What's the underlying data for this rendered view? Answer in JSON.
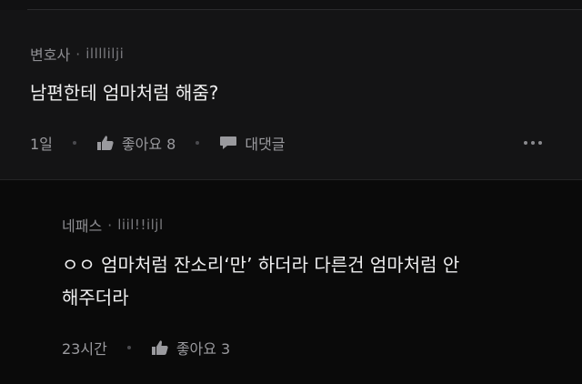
{
  "comment": {
    "author": "변호사",
    "separator": "·",
    "handle": "illllilji",
    "text": "남편한테 엄마처럼 해줌?",
    "time": "1일",
    "like_label": "좋아요 8",
    "reply_label": "대댓글"
  },
  "reply": {
    "author": "네패스",
    "separator": "·",
    "handle": "liil!!iljl",
    "text_line1": "ㅇㅇ 엄마처럼 잔소리‘만’ 하더라 다른건 엄마처럼 안",
    "text_line2": "해주더라",
    "time": "23시간",
    "like_label": "좋아요 3"
  },
  "icons": {
    "like": "thumbs-up-icon",
    "reply": "speech-bubble-icon",
    "more": "more-horizontal-icon"
  }
}
